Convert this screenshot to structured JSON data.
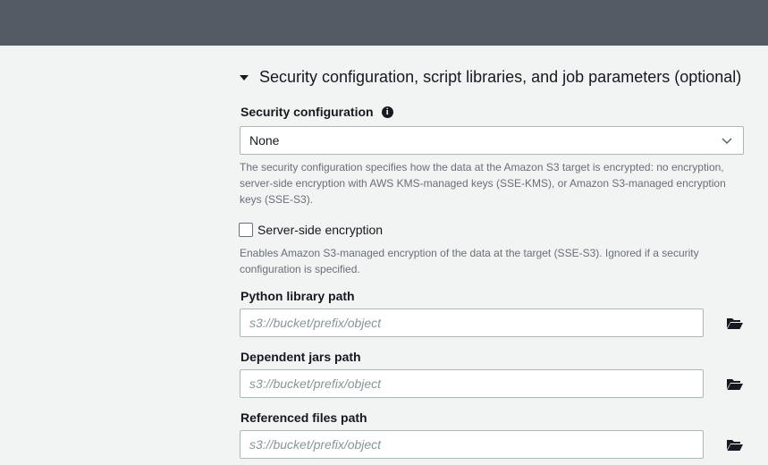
{
  "section": {
    "title": "Security configuration, script libraries, and job parameters (optional)"
  },
  "security_configuration": {
    "label": "Security configuration",
    "selected": "None",
    "help": "The security configuration specifies how the data at the Amazon S3 target is encrypted: no encryption, server-side encryption with AWS KMS-managed keys (SSE-KMS), or Amazon S3-managed encryption keys (SSE-S3)."
  },
  "server_side_encryption": {
    "label": "Server-side encryption",
    "checked": false,
    "help": "Enables Amazon S3-managed encryption of the data at the target (SSE-S3). Ignored if a security configuration is specified."
  },
  "python_library_path": {
    "label": "Python library path",
    "value": "",
    "placeholder": "s3://bucket/prefix/object"
  },
  "dependent_jars_path": {
    "label": "Dependent jars path",
    "value": "",
    "placeholder": "s3://bucket/prefix/object"
  },
  "referenced_files_path": {
    "label": "Referenced files path",
    "value": "",
    "placeholder": "s3://bucket/prefix/object"
  },
  "icons": {
    "caret": "caret-down-icon",
    "info": "info-icon",
    "chevron": "chevron-down-icon",
    "folder": "folder-open-icon"
  },
  "colors": {
    "topbar": "#545b64",
    "background": "#f2f3f3",
    "text": "#16191f",
    "help_text": "#687078",
    "border": "#aab7b8"
  }
}
